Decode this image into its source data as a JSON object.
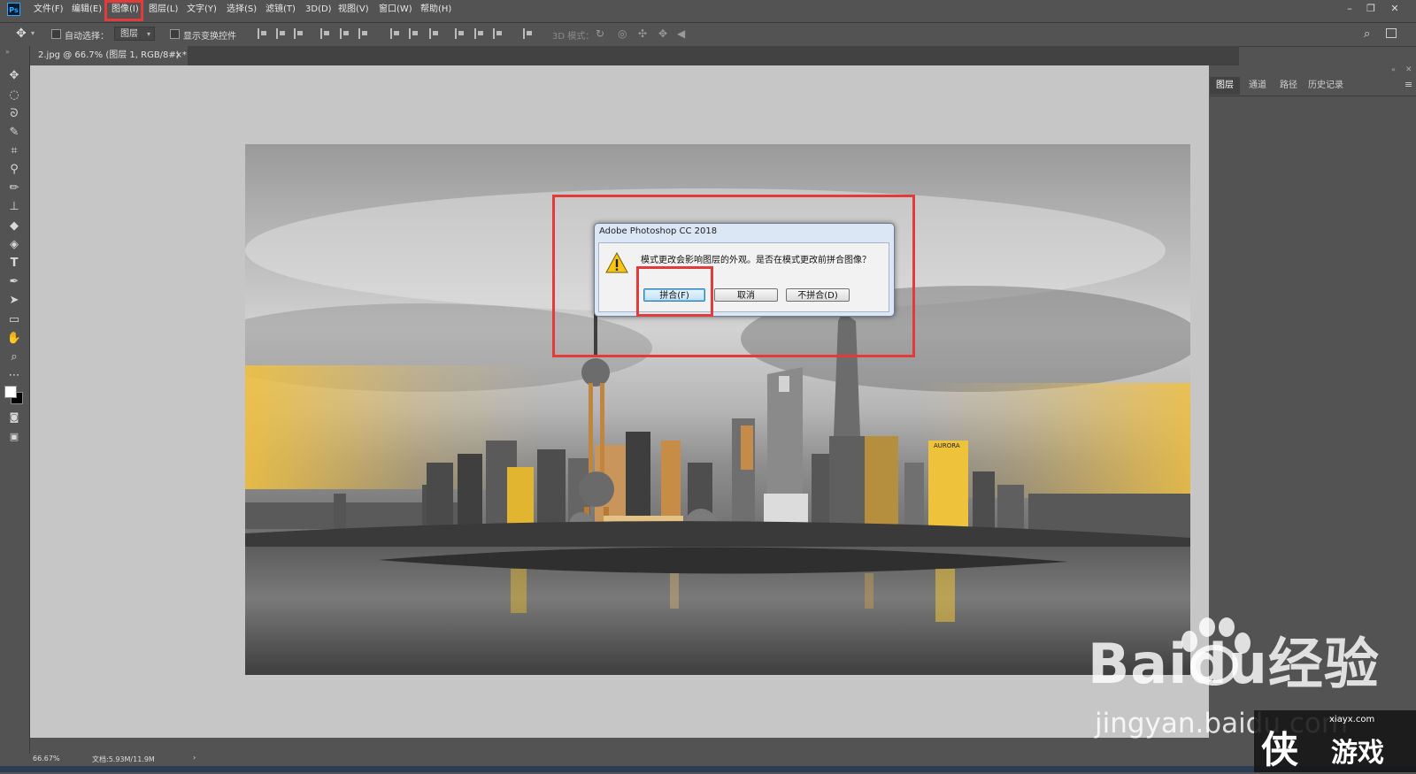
{
  "app": {
    "logo": "Ps"
  },
  "menubar": {
    "items": [
      "文件(F)",
      "编辑(E)",
      "图像(I)",
      "图层(L)",
      "文字(Y)",
      "选择(S)",
      "滤镜(T)",
      "3D(D)",
      "视图(V)",
      "窗口(W)",
      "帮助(H)"
    ],
    "highlighted": "图像(I)",
    "window_controls": [
      "–",
      "❐",
      "✕"
    ]
  },
  "options_bar": {
    "auto_select_label": "自动选择：",
    "auto_select_value": "图层",
    "show_transform_label": "显示变换控件",
    "mode_3d_label": "3D 模式："
  },
  "document_tab": {
    "title": "2.jpg @ 66.7% (图层 1, RGB/8#) *",
    "close": "×"
  },
  "panel_tabs": [
    "图层",
    "通道",
    "路径",
    "历史记录"
  ],
  "dialog": {
    "title": "Adobe Photoshop CC 2018",
    "message": "模式更改会影响图层的外观。是否在模式更改前拼合图像？",
    "buttons": {
      "flatten": "拼合(F)",
      "cancel": "取消",
      "dont_flatten": "不拼合(D)"
    }
  },
  "photo": {
    "sign_text": "AURORA"
  },
  "status_bar": {
    "zoom": "66.67%",
    "doc_info": "文档:5.93M/11.9M",
    "arrow": "›"
  },
  "watermarks": {
    "baidu": "Baidu经验",
    "baidu_url": "jingyan.baidu.com",
    "site_url": "xiayx.com",
    "site_name": "游戏",
    "site_logo": "侠"
  },
  "colors": {
    "highlight": "#e23b3b",
    "ui_bg": "#535353",
    "canvas_bg": "#c6c6c6",
    "dialog_frame": "#dce7f5"
  }
}
